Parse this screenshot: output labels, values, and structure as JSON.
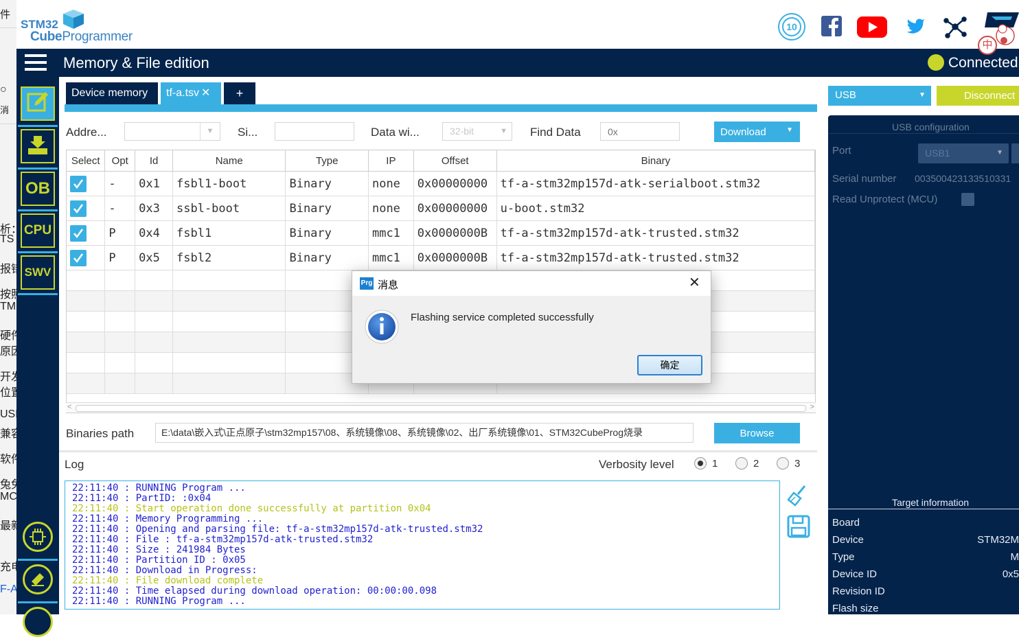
{
  "background_window": {
    "fragments": [
      "件",
      "消",
      "析：",
      "TS",
      "报错",
      "按照",
      "TM",
      "硬件",
      "原因",
      "开发",
      "位置",
      "USB",
      "兼容",
      "软件",
      "兔兔",
      "MC",
      "最新",
      "充电",
      "F-A"
    ]
  },
  "header": {
    "logo_line1": "STM32",
    "logo_cube": "Cube",
    "logo_programmer": "Programmer",
    "anniversary_badge": "10"
  },
  "titlebar": {
    "title": "Memory & File edition",
    "connection_status": "Connected"
  },
  "sidebar": {
    "items": [
      {
        "label": "",
        "icon": "pencil-icon"
      },
      {
        "label": "",
        "icon": "download-icon"
      },
      {
        "label": "OB"
      },
      {
        "label": "CPU"
      },
      {
        "label": "SWV"
      }
    ]
  },
  "tabs": [
    {
      "label": "Device memory"
    },
    {
      "label": "tf-a.tsv"
    },
    {
      "label": "+"
    }
  ],
  "toolbar": {
    "address_label": "Addre...",
    "size_label": "Si...",
    "data_width_label": "Data wi...",
    "data_width_value": "32-bit",
    "find_data_label": "Find Data",
    "find_data_placeholder": "0x",
    "download_label": "Download"
  },
  "table": {
    "columns": [
      "Select",
      "Opt",
      "Id",
      "Name",
      "Type",
      "IP",
      "Offset",
      "Binary"
    ],
    "rows": [
      {
        "opt": "-",
        "id": "0x1",
        "name": "fsbl1-boot",
        "type": "Binary",
        "ip": "none",
        "offset": "0x00000000",
        "binary": "tf-a-stm32mp157d-atk-serialboot.stm32"
      },
      {
        "opt": "-",
        "id": "0x3",
        "name": "ssbl-boot",
        "type": "Binary",
        "ip": "none",
        "offset": "0x00000000",
        "binary": "u-boot.stm32"
      },
      {
        "opt": "P",
        "id": "0x4",
        "name": "fsbl1",
        "type": "Binary",
        "ip": "mmc1",
        "offset": "0x0000000B",
        "binary": "tf-a-stm32mp157d-atk-trusted.stm32"
      },
      {
        "opt": "P",
        "id": "0x5",
        "name": "fsbl2",
        "type": "Binary",
        "ip": "mmc1",
        "offset": "0x0000000B",
        "binary": "tf-a-stm32mp157d-atk-trusted.stm32"
      }
    ]
  },
  "binaries": {
    "label": "Binaries path",
    "path": "E:\\data\\嵌入式\\正点原子\\stm32mp157\\08、系统镜像\\08、系统镜像\\02、出厂系统镜像\\01、STM32CubeProg烧录",
    "browse_label": "Browse"
  },
  "log": {
    "label": "Log",
    "verbosity_label": "Verbosity level",
    "verbosity_options": [
      "1",
      "2",
      "3"
    ],
    "verbosity_selected": "1",
    "lines": [
      {
        "text": "22:11:40 : RUNNING Program ...",
        "color": "#1f1fd0"
      },
      {
        "text": "22:11:40 : PartID: :0x04",
        "color": "#1f1fd0"
      },
      {
        "text": "22:11:40 : Start operation done successfully at partition 0x04",
        "color": "#b7c21a"
      },
      {
        "text": "22:11:40 : Memory Programming ...",
        "color": "#1f1fd0"
      },
      {
        "text": "22:11:40 : Opening and parsing file: tf-a-stm32mp157d-atk-trusted.stm32",
        "color": "#1f1fd0"
      },
      {
        "text": "22:11:40 : File : tf-a-stm32mp157d-atk-trusted.stm32",
        "color": "#1f1fd0"
      },
      {
        "text": "22:11:40 : Size : 241984 Bytes",
        "color": "#1f1fd0"
      },
      {
        "text": "22:11:40 : Partition ID : 0x05",
        "color": "#1f1fd0"
      },
      {
        "text": "22:11:40 : Download in Progress:",
        "color": "#1f1fd0"
      },
      {
        "text": "22:11:40 : File download complete",
        "color": "#b7c21a"
      },
      {
        "text": "22:11:40 : Time elapsed during download operation: 00:00:00.098",
        "color": "#1f1fd0"
      },
      {
        "text": "22:11:40 : RUNNING Program ...",
        "color": "#1f1fd0"
      }
    ]
  },
  "right_panel": {
    "interface": "USB",
    "disconnect_label": "Disconnect",
    "config_title": "USB configuration",
    "port_label": "Port",
    "port_value": "USB1",
    "serial_label": "Serial number",
    "serial_value": "003500423133510331",
    "read_unprotect_label": "Read Unprotect (MCU)",
    "target_title": "Target information",
    "target_rows": [
      {
        "label": "Board",
        "value": ""
      },
      {
        "label": "Device",
        "value": "STM32M"
      },
      {
        "label": "Type",
        "value": "M"
      },
      {
        "label": "Device ID",
        "value": "0x5"
      },
      {
        "label": "Revision ID",
        "value": ""
      },
      {
        "label": "Flash size",
        "value": ""
      }
    ]
  },
  "dialog": {
    "app_icon_text": "Prg",
    "title": "消息",
    "message": "Flashing service completed successfully",
    "ok_label": "确定"
  },
  "colors": {
    "navy": "#03234b",
    "accent_blue": "#3ab0e2",
    "accent_lime": "#c8d62b"
  }
}
